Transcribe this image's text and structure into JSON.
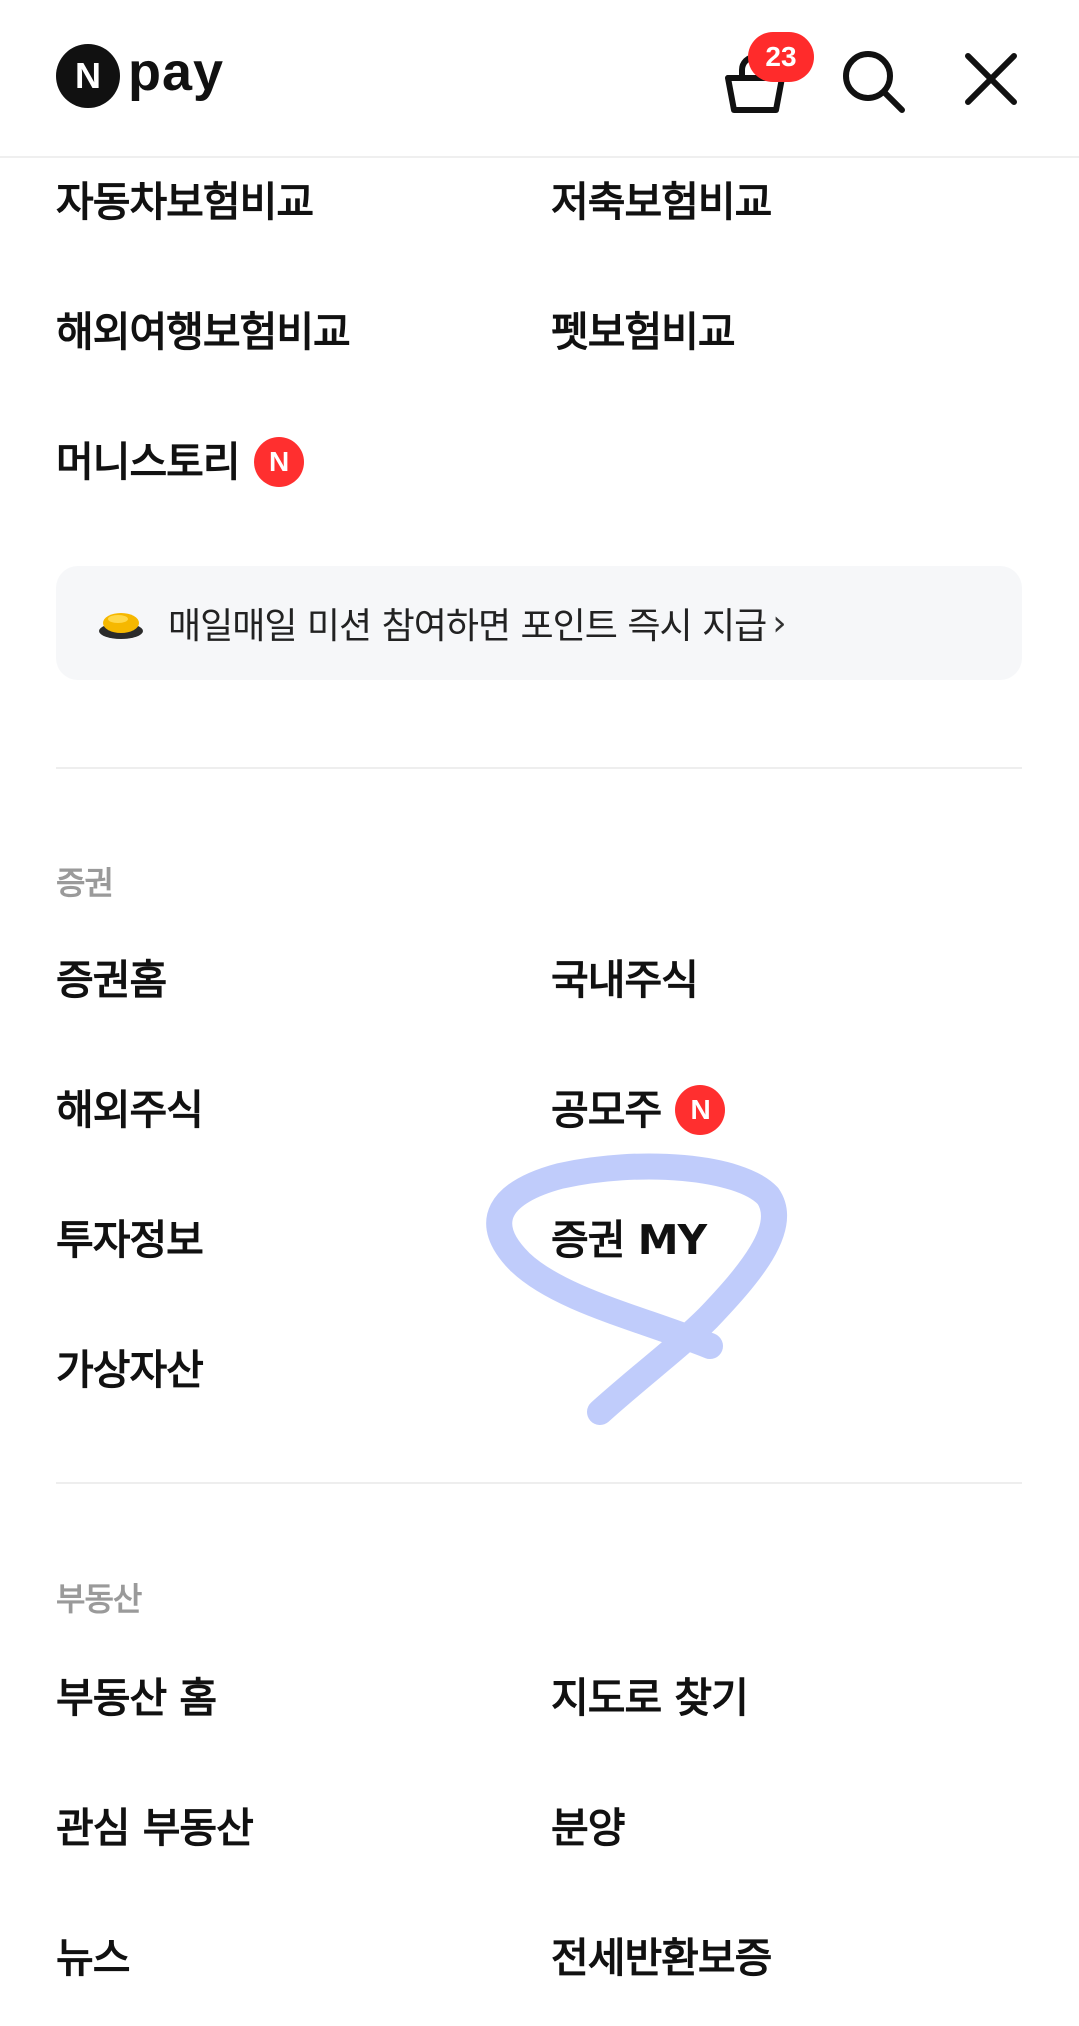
{
  "header": {
    "logo_mark": "N",
    "logo_text": "pay",
    "cart_count": "23",
    "icons": [
      "cart-icon",
      "search-icon",
      "close-icon"
    ]
  },
  "insurance": {
    "items": [
      {
        "label": "자동차보험비교"
      },
      {
        "label": "저축보험비교"
      },
      {
        "label": "해외여행보험비교"
      },
      {
        "label": "펫보험비교"
      },
      {
        "label": "머니스토리",
        "new": "N"
      }
    ]
  },
  "banner": {
    "text": "매일매일 미션 참여하면 포인트 즉시 지급",
    "chevron": "›",
    "icon": "coin-icon"
  },
  "securities": {
    "title": "증권",
    "items": [
      {
        "label": "증권홈"
      },
      {
        "label": "국내주식"
      },
      {
        "label": "해외주식"
      },
      {
        "label": "공모주",
        "new": "N"
      },
      {
        "label": "투자정보"
      },
      {
        "label": "증권 MY"
      },
      {
        "label": "가상자산"
      }
    ]
  },
  "realestate": {
    "title": "부동산",
    "items": [
      {
        "label": "부동산 홈"
      },
      {
        "label": "지도로 찾기"
      },
      {
        "label": "관심 부동산"
      },
      {
        "label": "분양"
      },
      {
        "label": "뉴스"
      },
      {
        "label": "전세반환보증"
      }
    ]
  },
  "colors": {
    "accent_red": "#ff2f2f",
    "annotation_blue": "#b9c6fb",
    "section_gray": "#9a9a9a"
  }
}
